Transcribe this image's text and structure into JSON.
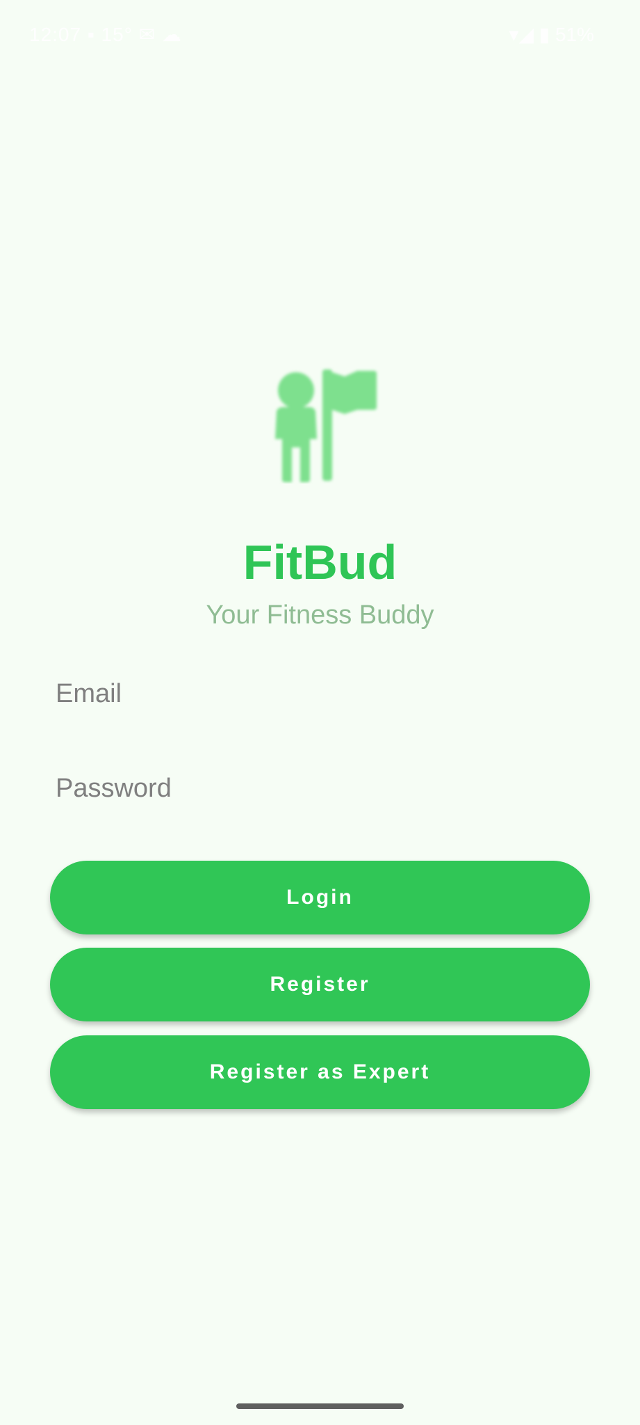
{
  "status_bar": {
    "left_text": "12:07 ▪ 15° ✉ ☁",
    "right_text": "▾◢ ▮ 51%"
  },
  "app": {
    "logo_icon": "person-with-flag-icon",
    "title": "FitBud",
    "tagline": "Your Fitness Buddy"
  },
  "form": {
    "email_placeholder": "Email",
    "email_value": "",
    "password_placeholder": "Password",
    "password_value": ""
  },
  "buttons": {
    "login_label": "Login",
    "register_label": "Register",
    "register_expert_label": "Register as Expert"
  },
  "colors": {
    "background": "#f6fdf5",
    "accent": "#30c656",
    "title": "#2fc556",
    "tagline": "#8fbc93",
    "logo": "#7ee08e"
  }
}
